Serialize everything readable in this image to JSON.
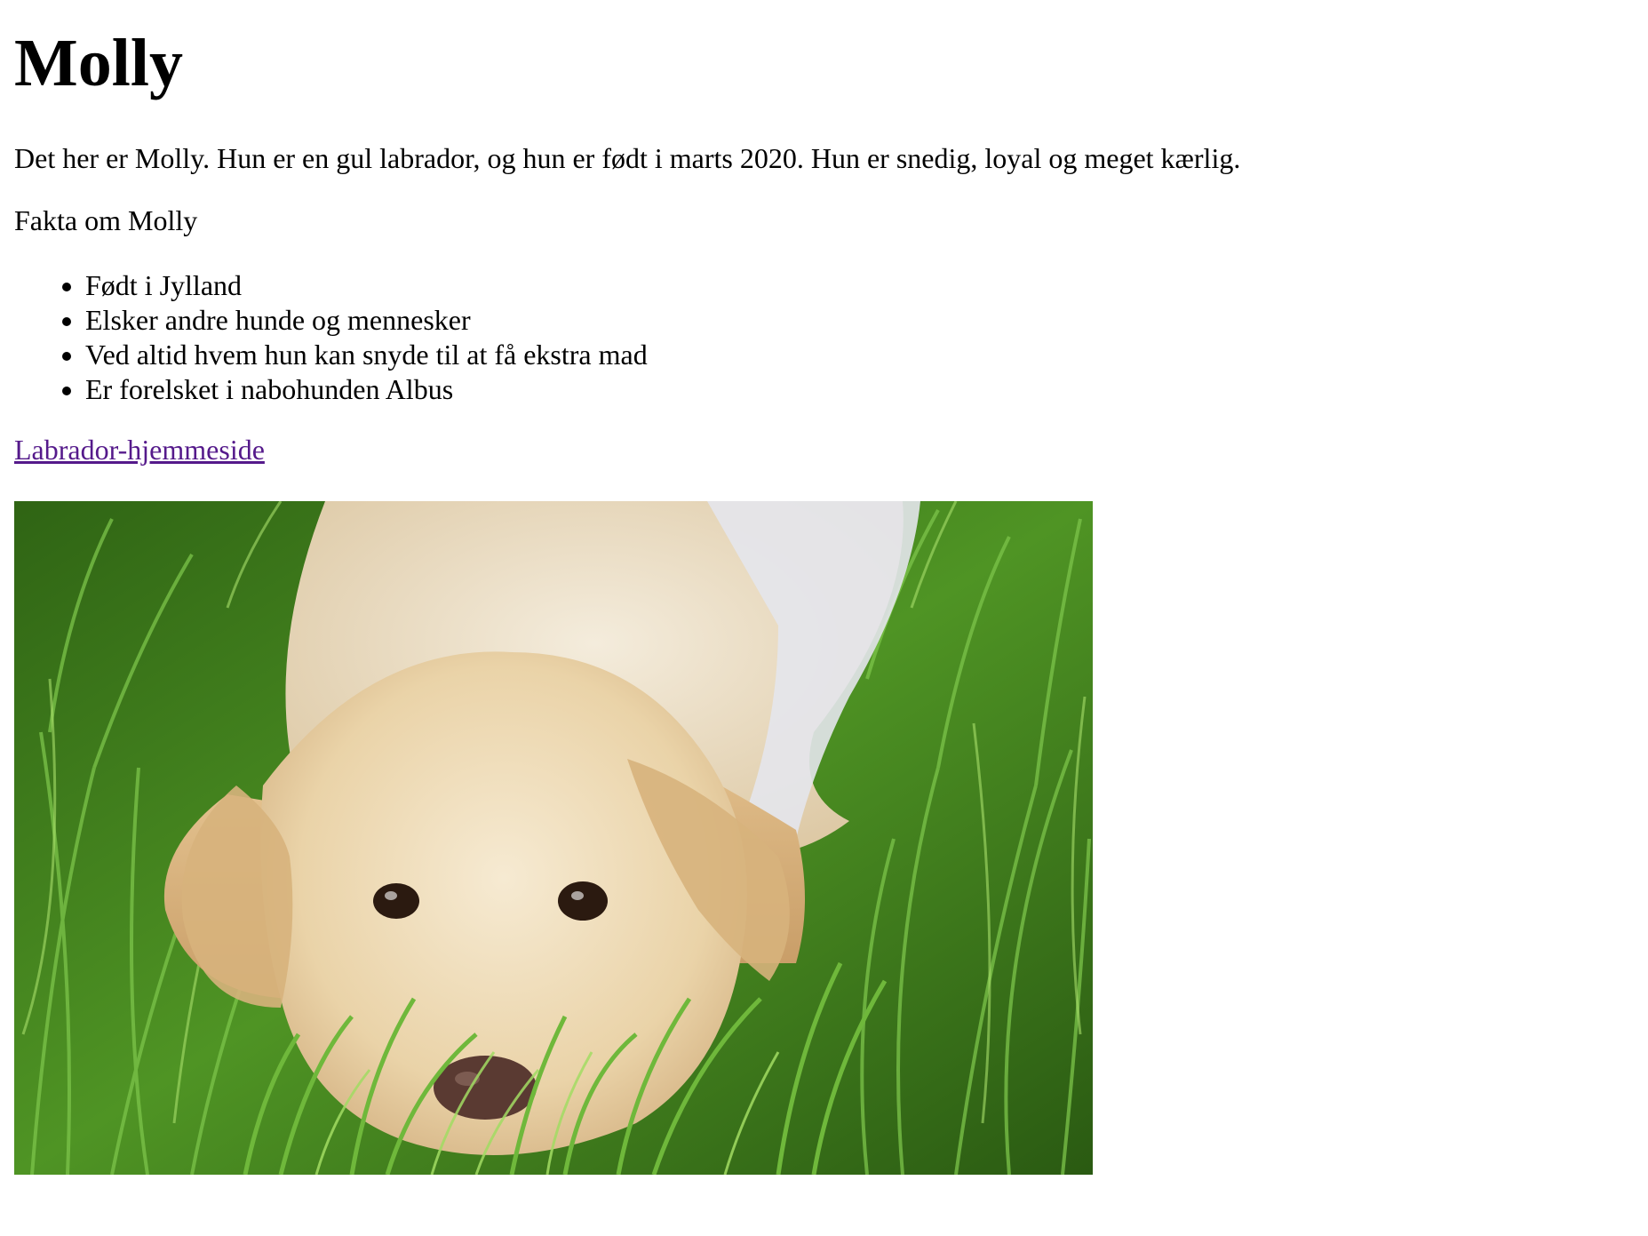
{
  "page": {
    "title": "Molly",
    "intro": "Det her er Molly. Hun er en gul labrador, og hun er født i marts 2020. Hun er snedig, loyal og meget kærlig.",
    "facts_heading": "Fakta om Molly",
    "facts": [
      "Født i Jylland",
      "Elsker andre hunde og mennesker",
      "Ved altid hvem hun kan snyde til at få ekstra mad",
      "Er forelsket i nabohunden Albus"
    ],
    "link_label": "Labrador-hjemmeside"
  },
  "colors": {
    "link_visited": "#551a8b",
    "grass_dark": "#2f6414",
    "grass_light": "#7cc44a",
    "fur_light": "#f1e2c4",
    "fur_dark": "#d8b98c"
  }
}
